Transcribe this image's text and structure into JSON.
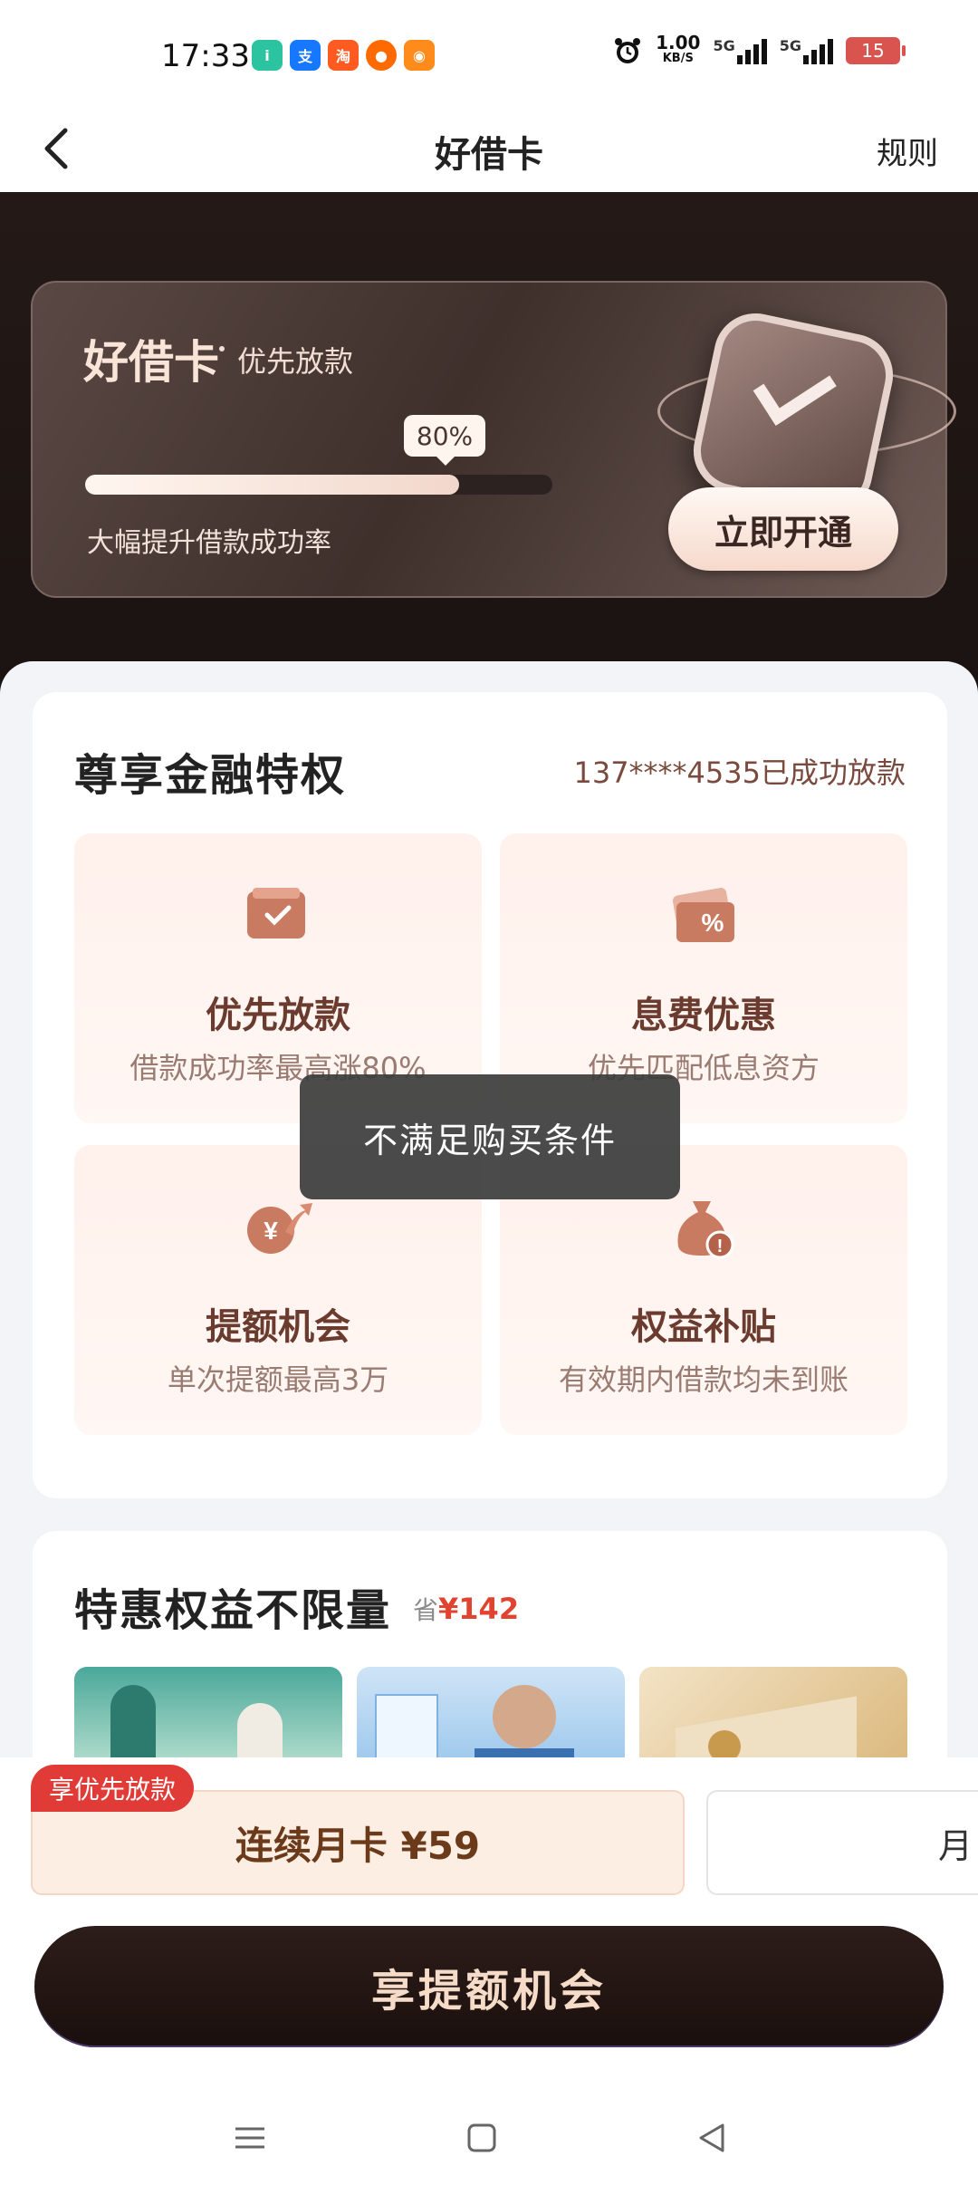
{
  "status_bar": {
    "time": "17:33",
    "net_speed": "1.00",
    "net_unit": "KB/S",
    "signal1": "5G",
    "signal2": "5G",
    "battery": "15"
  },
  "header": {
    "title": "好借卡",
    "rule_link": "规则"
  },
  "hero": {
    "card_title": "好借卡",
    "card_subtitle": "优先放款",
    "progress_label": "80%",
    "progress_fraction": 0.8,
    "description": "大幅提升借款成功率",
    "open_button": "立即开通"
  },
  "privileges": {
    "title": "尊享金融特权",
    "note": "137****4535已成功放款",
    "items": [
      {
        "name": "优先放款",
        "desc": "借款成功率最高涨80%",
        "icon": "wallet-check-icon"
      },
      {
        "name": "息费优惠",
        "desc": "优先匹配低息资方",
        "icon": "discount-ticket-icon"
      },
      {
        "name": "提额机会",
        "desc": "单次提额最高3万",
        "icon": "yuan-arrow-icon"
      },
      {
        "name": "权益补贴",
        "desc": "有效期内借款均未到账",
        "icon": "money-bag-icon"
      }
    ]
  },
  "toast": "不满足购买条件",
  "unlimited": {
    "title": "特惠权益不限量",
    "save_prefix": "省",
    "save_amount": "¥142"
  },
  "plans": {
    "tag": "享优先放款",
    "option1": "连续月卡 ¥59",
    "option2_partial": "月"
  },
  "cta": "享提额机会",
  "colors": {
    "accent_dark": "#1f1412",
    "accent_brown": "#6a3b2e",
    "tag_red": "#e13b38",
    "price_red": "#e0432f"
  }
}
